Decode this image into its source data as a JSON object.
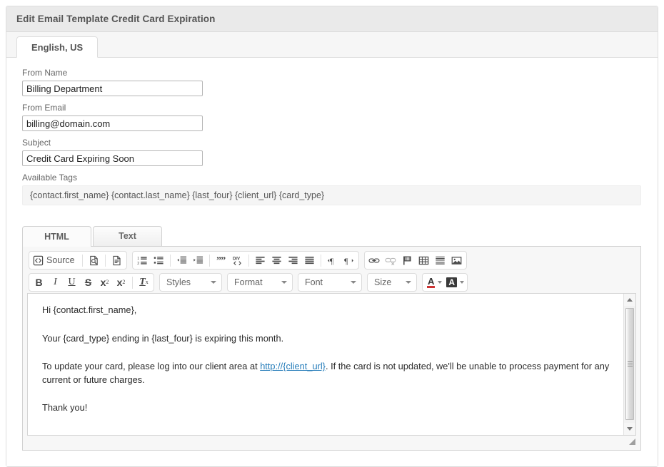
{
  "panel": {
    "title": "Edit Email Template Credit Card Expiration"
  },
  "language_tabs": [
    {
      "label": "English, US",
      "active": true
    }
  ],
  "form": {
    "from_name": {
      "label": "From Name",
      "value": "Billing Department",
      "placeholder": ""
    },
    "from_email": {
      "label": "From Email",
      "value": "billing@domain.com",
      "placeholder": ""
    },
    "subject": {
      "label": "Subject",
      "value": "Credit Card Expiring Soon",
      "placeholder": ""
    },
    "available_tags": {
      "label": "Available Tags",
      "value": "{contact.first_name} {contact.last_name} {last_four} {client_url} {card_type}"
    }
  },
  "editor": {
    "tabs": [
      {
        "label": "HTML",
        "active": true
      },
      {
        "label": "Text",
        "active": false
      }
    ],
    "toolbar_row1": [
      {
        "name": "source-button",
        "label": "Source",
        "icon": "source-code-icon",
        "disabled": false
      },
      {
        "name": "preview-button",
        "label": "",
        "icon": "preview-icon",
        "disabled": false
      },
      {
        "name": "templates-button",
        "label": "",
        "icon": "templates-document-icon",
        "disabled": false
      },
      {
        "name": "numbered-list-button",
        "label": "",
        "icon": "numbered-list-icon",
        "disabled": false
      },
      {
        "name": "bulleted-list-button",
        "label": "",
        "icon": "bulleted-list-icon",
        "disabled": false
      },
      {
        "name": "decrease-indent-button",
        "label": "",
        "icon": "outdent-icon",
        "disabled": false
      },
      {
        "name": "increase-indent-button",
        "label": "",
        "icon": "indent-icon",
        "disabled": false
      },
      {
        "name": "blockquote-button",
        "label": "",
        "icon": "blockquote-icon",
        "disabled": false
      },
      {
        "name": "div-container-button",
        "label": "",
        "icon": "div-container-icon",
        "disabled": false
      },
      {
        "name": "align-left-button",
        "label": "",
        "icon": "align-left-icon",
        "disabled": false
      },
      {
        "name": "align-center-button",
        "label": "",
        "icon": "align-center-icon",
        "disabled": false
      },
      {
        "name": "align-right-button",
        "label": "",
        "icon": "align-right-icon",
        "disabled": false
      },
      {
        "name": "align-justify-button",
        "label": "",
        "icon": "align-justify-icon",
        "disabled": false
      },
      {
        "name": "text-direction-ltr-button",
        "label": "",
        "icon": "direction-ltr-icon",
        "disabled": false
      },
      {
        "name": "text-direction-rtl-button",
        "label": "",
        "icon": "direction-rtl-icon",
        "disabled": false
      },
      {
        "name": "link-button",
        "label": "",
        "icon": "link-icon",
        "disabled": false
      },
      {
        "name": "unlink-button",
        "label": "",
        "icon": "unlink-icon",
        "disabled": true
      },
      {
        "name": "anchor-button",
        "label": "",
        "icon": "anchor-flag-icon",
        "disabled": false
      },
      {
        "name": "table-button",
        "label": "",
        "icon": "table-icon",
        "disabled": false
      },
      {
        "name": "horizontal-rule-button",
        "label": "",
        "icon": "horizontal-rule-icon",
        "disabled": false
      },
      {
        "name": "image-button",
        "label": "",
        "icon": "image-icon",
        "disabled": false
      }
    ],
    "toolbar_row2": {
      "bold": "B",
      "italic": "I",
      "underline": "U",
      "strike": "S",
      "subscript": "x",
      "subscript_mark": "2",
      "superscript": "x",
      "superscript_mark": "2",
      "remove_format": "T",
      "remove_format_mark": "x",
      "styles_select": "Styles",
      "format_select": "Format",
      "font_select": "Font",
      "size_select": "Size",
      "text_color": "A",
      "background_color": "A"
    },
    "content": {
      "greeting": "Hi {contact.first_name},",
      "paragraph_1": "Your {card_type} ending in {last_four} is expiring this month.",
      "paragraph_2_before_link": "To update your card, please log into our client area at ",
      "link_text": "http://{client_url}",
      "paragraph_2_after_link": ". If the card is not updated, we'll be unable to process payment for any current or future charges.",
      "closing": "Thank you!"
    }
  },
  "colors": {
    "panel_header_bg": "#eaeaea",
    "panel_border": "#dddddd",
    "link": "#2a7fbb",
    "text_color_swatch": "#cc3333",
    "background_color_swatch": "#3a3a3a",
    "tags_bg": "#f5f5f5"
  }
}
